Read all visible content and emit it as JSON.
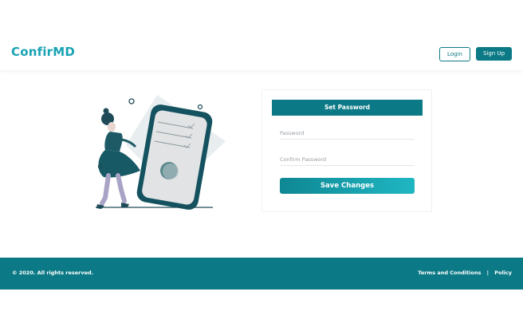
{
  "header": {
    "logo": "ConfirMD",
    "login_label": "Login",
    "signup_label": "Sign Up"
  },
  "form": {
    "title": "Set Password",
    "password_placeholder": "Password",
    "confirm_placeholder": "Confirm Password",
    "save_label": "Save Changes"
  },
  "footer": {
    "copyright": "© 2020. All rights reserved.",
    "terms_label": "Terms and Conditions",
    "separator": "|",
    "policy_label": "Policy"
  },
  "colors": {
    "brand": "#0c7a86",
    "logo": "#1aa3b5",
    "button_gradient_end": "#1fb7c3"
  }
}
